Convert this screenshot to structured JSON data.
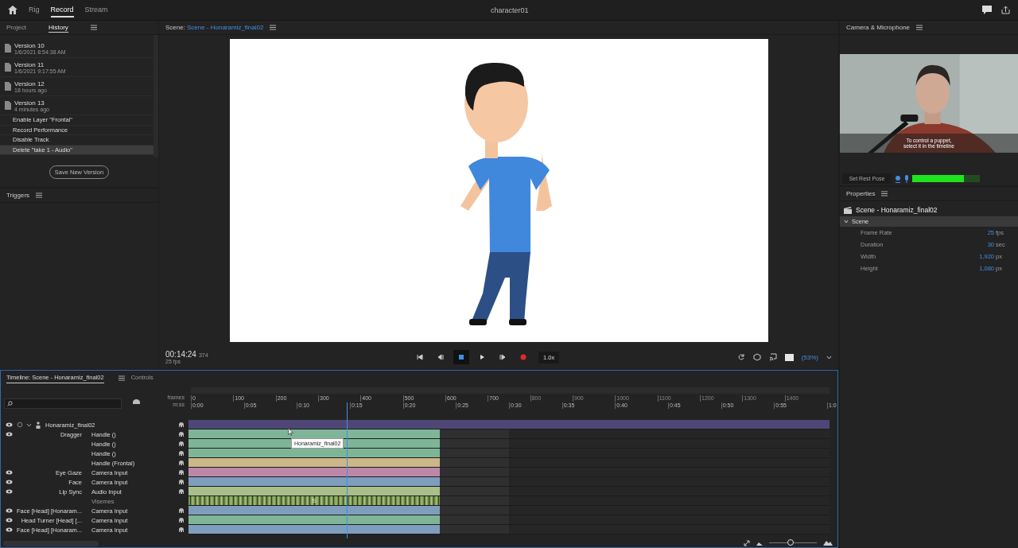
{
  "top_bar": {
    "tabs": [
      {
        "label": "Rig",
        "selected": false
      },
      {
        "label": "Record",
        "selected": true
      },
      {
        "label": "Stream",
        "selected": false
      }
    ],
    "title": "character01"
  },
  "left_panel": {
    "tabs": [
      {
        "label": "Project",
        "selected": false
      },
      {
        "label": "History",
        "selected": true
      }
    ],
    "history": [
      {
        "kind": "version",
        "name": "Version 10",
        "sub": "1/6/2021 8:54:38 AM",
        "selected": false
      },
      {
        "kind": "version",
        "name": "Version 11",
        "sub": "1/6/2021 9:17:55 AM",
        "selected": false
      },
      {
        "kind": "version",
        "name": "Version 12",
        "sub": "18 hours ago",
        "selected": false
      },
      {
        "kind": "version",
        "name": "Version 13",
        "sub": "4 minutes ago",
        "selected": false
      },
      {
        "kind": "action",
        "name": "Enable Layer \"Frontal\"",
        "selected": false
      },
      {
        "kind": "action",
        "name": "Record Performance",
        "selected": false
      },
      {
        "kind": "action",
        "name": "Disable Track",
        "selected": false
      },
      {
        "kind": "action",
        "name": "Delete \"take 1 - Audio\"",
        "selected": true
      }
    ],
    "save_button": "Save New Version",
    "triggers_title": "Triggers"
  },
  "scene": {
    "label": "Scene:",
    "name": "Scene - Honaramiz_final02"
  },
  "transport": {
    "time": "00:14:24",
    "frame": "374",
    "fps": "25 fps",
    "speed": "1.0x",
    "zoom": "(53%)",
    "buttons": [
      {
        "kind": "first",
        "selected": false
      },
      {
        "kind": "prev",
        "selected": false
      },
      {
        "kind": "stop",
        "selected": true
      },
      {
        "kind": "play",
        "selected": false
      },
      {
        "kind": "next",
        "selected": false
      },
      {
        "kind": "record",
        "selected": false
      }
    ]
  },
  "timeline": {
    "tabs": [
      {
        "label": "Timeline: Scene - Honaramiz_final02",
        "selected": true
      },
      {
        "label": "Controls",
        "selected": false
      }
    ],
    "frames_label": "frames",
    "time_label": "m:ss",
    "frames": [
      "0",
      "100",
      "200",
      "300",
      "400",
      "500",
      "600",
      "700",
      "800",
      "900",
      "1000",
      "1100",
      "1200",
      "1300",
      "1400"
    ],
    "times": [
      "0:00",
      "0:05",
      "0:10",
      "0:15",
      "0:20",
      "0:25",
      "0:30",
      "0:35",
      "0:40",
      "0:45",
      "0:50",
      "0:55",
      "1:0"
    ],
    "playhead": {
      "level": 0.249
    },
    "tooltip": "Honaramiz_final02",
    "rows": [
      {
        "kind": "puppet",
        "name": "Honaramiz_final02",
        "behavior": "",
        "eye": true,
        "color": "#4e4776"
      },
      {
        "kind": "behavior",
        "name": "Dragger",
        "behavior": "Handle ()",
        "eye": true,
        "color": "#7fb597"
      },
      {
        "kind": "behavior",
        "name": "",
        "behavior": "Handle ()",
        "eye": false,
        "color": "#7fb597"
      },
      {
        "kind": "behavior",
        "name": "",
        "behavior": "Handle ()",
        "eye": false,
        "color": "#7fb597"
      },
      {
        "kind": "behavior",
        "name": "",
        "behavior": "Handle (Frontal)",
        "eye": false,
        "color": "#cbb78a"
      },
      {
        "kind": "behavior",
        "name": "Eye Gaze",
        "behavior": "Camera Input",
        "eye": true,
        "color": "#bd88a8"
      },
      {
        "kind": "behavior",
        "name": "Face",
        "behavior": "Camera Input",
        "eye": true,
        "color": "#7f9dbd"
      },
      {
        "kind": "behavior",
        "name": "Lip Sync",
        "behavior": "Audio Input",
        "eye": true,
        "color": "#a9be8a"
      },
      {
        "kind": "visemes",
        "name": "",
        "behavior": "Visemes",
        "eye": false,
        "color": "#7d9a52",
        "viseme": "S"
      },
      {
        "kind": "behavior",
        "name": "Face [Head] [Honaram...",
        "behavior": "Camera Input",
        "eye": true,
        "color": "#7f9dbd"
      },
      {
        "kind": "behavior",
        "name": "Head Turner [Head] [...",
        "behavior": "Camera Input",
        "eye": true,
        "color": "#7fb597"
      },
      {
        "kind": "behavior",
        "name": "Face [Head] [Honaram...",
        "behavior": "Camera Input",
        "eye": true,
        "color": "#7f9dbd"
      }
    ],
    "zoom_slider": {
      "level": 0.45
    }
  },
  "camera": {
    "title": "Camera & Microphone",
    "hint": "To control a puppet,\nselect it in the timeline",
    "rest_pose": "Set Rest Pose",
    "mic": {
      "level": 0.76
    }
  },
  "properties": {
    "title": "Properties",
    "object": "Scene - Honaramiz_final02",
    "section": "Scene",
    "expanded": true,
    "rows": [
      {
        "label": "Frame Rate",
        "value": "25",
        "unit": "fps"
      },
      {
        "label": "Duration",
        "value": "30",
        "unit": "sec"
      },
      {
        "label": "Width",
        "value": "1,920",
        "unit": "px"
      },
      {
        "label": "Height",
        "value": "1,080",
        "unit": "px"
      }
    ]
  }
}
